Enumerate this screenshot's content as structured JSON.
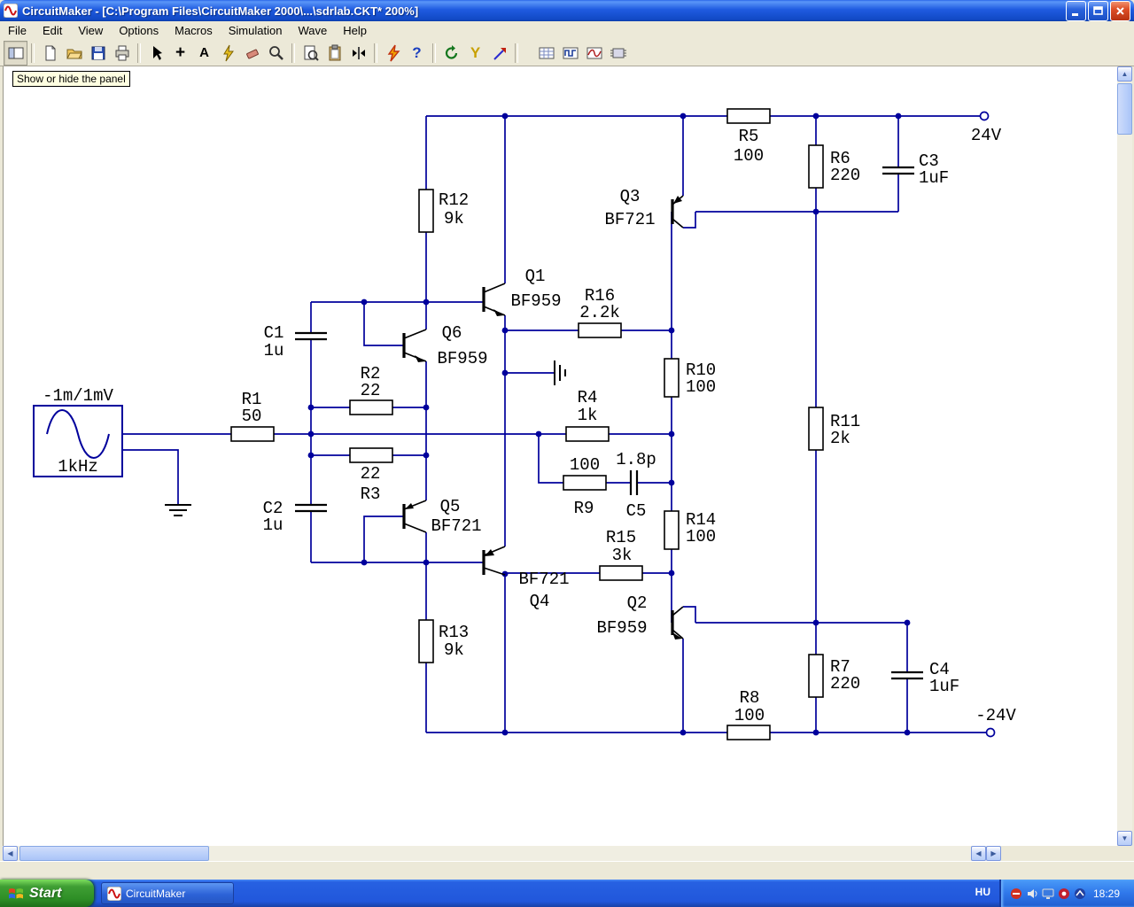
{
  "window": {
    "title": "CircuitMaker - [C:\\Program Files\\CircuitMaker 2000\\...\\sdrlab.CKT* 200%]"
  },
  "menu": {
    "items": [
      "File",
      "Edit",
      "View",
      "Options",
      "Macros",
      "Simulation",
      "Wave",
      "Help"
    ]
  },
  "toolbar": {
    "tooltip": "Show or hide the panel",
    "glyphs": {
      "plus": "+",
      "text": "A",
      "help": "?",
      "probe": "Y"
    }
  },
  "schematic": {
    "rails": {
      "vplus": "24V",
      "vminus": "-24V"
    },
    "source": {
      "amplitude": "-1m/1mV",
      "frequency": "1kHz"
    },
    "components": {
      "R1": {
        "ref": "R1",
        "value": "50"
      },
      "R2": {
        "ref": "R2",
        "value": "22"
      },
      "R3": {
        "ref": "R3",
        "value": "22"
      },
      "R4": {
        "ref": "R4",
        "value": "1k"
      },
      "R5": {
        "ref": "R5",
        "value": "100"
      },
      "R6": {
        "ref": "R6",
        "value": "220"
      },
      "R7": {
        "ref": "R7",
        "value": "220"
      },
      "R8": {
        "ref": "R8",
        "value": "100"
      },
      "R9": {
        "ref": "R9",
        "value": "100"
      },
      "R10": {
        "ref": "R10",
        "value": "100"
      },
      "R11": {
        "ref": "R11",
        "value": "2k"
      },
      "R12": {
        "ref": "R12",
        "value": "9k"
      },
      "R13": {
        "ref": "R13",
        "value": "9k"
      },
      "R14": {
        "ref": "R14",
        "value": "100"
      },
      "R15": {
        "ref": "R15",
        "value": "3k"
      },
      "R16": {
        "ref": "R16",
        "value": "2.2k"
      },
      "C1": {
        "ref": "C1",
        "value": "1u"
      },
      "C2": {
        "ref": "C2",
        "value": "1u"
      },
      "C3": {
        "ref": "C3",
        "value": "1uF"
      },
      "C4": {
        "ref": "C4",
        "value": "1uF"
      },
      "C5": {
        "ref": "C5",
        "value": "1.8p"
      },
      "Q1": {
        "ref": "Q1",
        "value": "BF959"
      },
      "Q2": {
        "ref": "Q2",
        "value": "BF959"
      },
      "Q3": {
        "ref": "Q3",
        "value": "BF721"
      },
      "Q4": {
        "ref": "Q4",
        "value": "BF721"
      },
      "Q5": {
        "ref": "Q5",
        "value": "BF721"
      },
      "Q6": {
        "ref": "Q6",
        "value": "BF959"
      }
    }
  },
  "taskbar": {
    "start_label": "Start",
    "task_label": "CircuitMaker",
    "language": "HU",
    "clock": "18:29"
  }
}
